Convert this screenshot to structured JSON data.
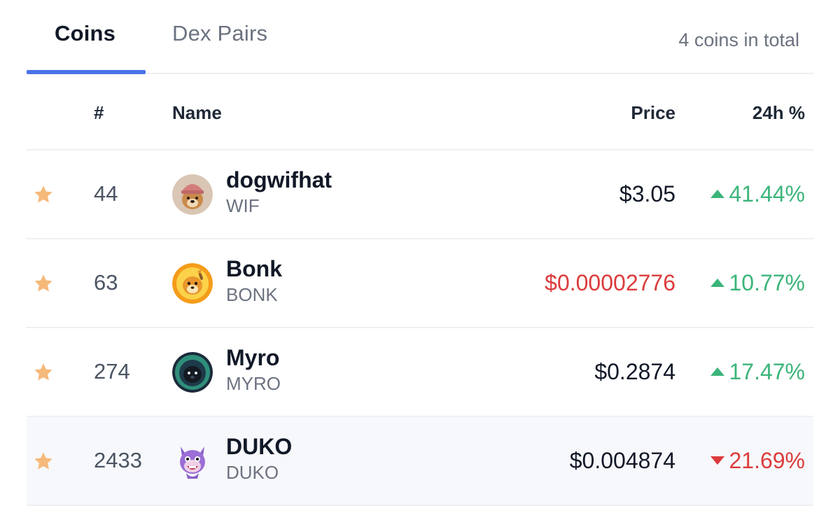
{
  "tabs": {
    "coins": "Coins",
    "dex_pairs": "Dex Pairs",
    "total": "4 coins in total"
  },
  "table": {
    "headers": {
      "rank": "#",
      "name": "Name",
      "price": "Price",
      "change": "24h %"
    },
    "rows": [
      {
        "rank": "44",
        "name": "dogwifhat",
        "symbol": "WIF",
        "price": "$3.05",
        "change": "41.44%",
        "direction": "up",
        "logo": "dogwifhat-logo"
      },
      {
        "rank": "63",
        "name": "Bonk",
        "symbol": "BONK",
        "price": "$0.00002776",
        "change": "10.77%",
        "direction": "up",
        "logo": "bonk-logo"
      },
      {
        "rank": "274",
        "name": "Myro",
        "symbol": "MYRO",
        "price": "$0.2874",
        "change": "17.47%",
        "direction": "up",
        "logo": "myro-logo"
      },
      {
        "rank": "2433",
        "name": "DUKO",
        "symbol": "DUKO",
        "price": "$0.004874",
        "change": "21.69%",
        "direction": "down",
        "logo": "duko-logo"
      }
    ]
  },
  "colors": {
    "accent": "#4b73e6",
    "positive": "#3bb57a",
    "negative": "#dc3b3b",
    "star": "#f5b97a"
  }
}
